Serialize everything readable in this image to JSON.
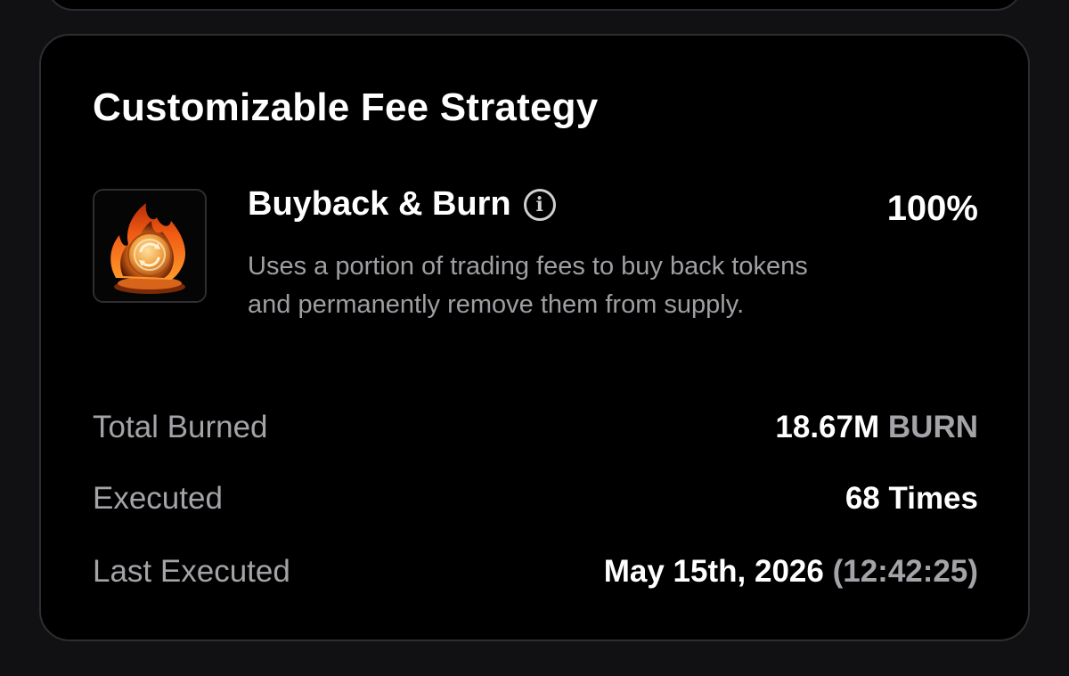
{
  "card": {
    "title": "Customizable Fee Strategy"
  },
  "strategy": {
    "icon": "flame-coin-icon",
    "name": "Buyback & Burn",
    "info_icon": "info-icon",
    "info_glyph": "i",
    "percent": "100%",
    "description": "Uses a portion of trading fees to buy back tokens and permanently remove them from supply."
  },
  "stats": {
    "total_burned": {
      "label": "Total Burned",
      "amount": "18.67M",
      "unit": "BURN"
    },
    "executed": {
      "label": "Executed",
      "value": "68 Times"
    },
    "last_executed": {
      "label": "Last Executed",
      "date": "May 15th, 2026",
      "time": "(12:42:25)"
    }
  },
  "colors": {
    "background": "#000000",
    "border": "#2e2e31",
    "text_primary": "#ffffff",
    "text_muted": "#a3a3a8",
    "flame": "#f08a24"
  }
}
